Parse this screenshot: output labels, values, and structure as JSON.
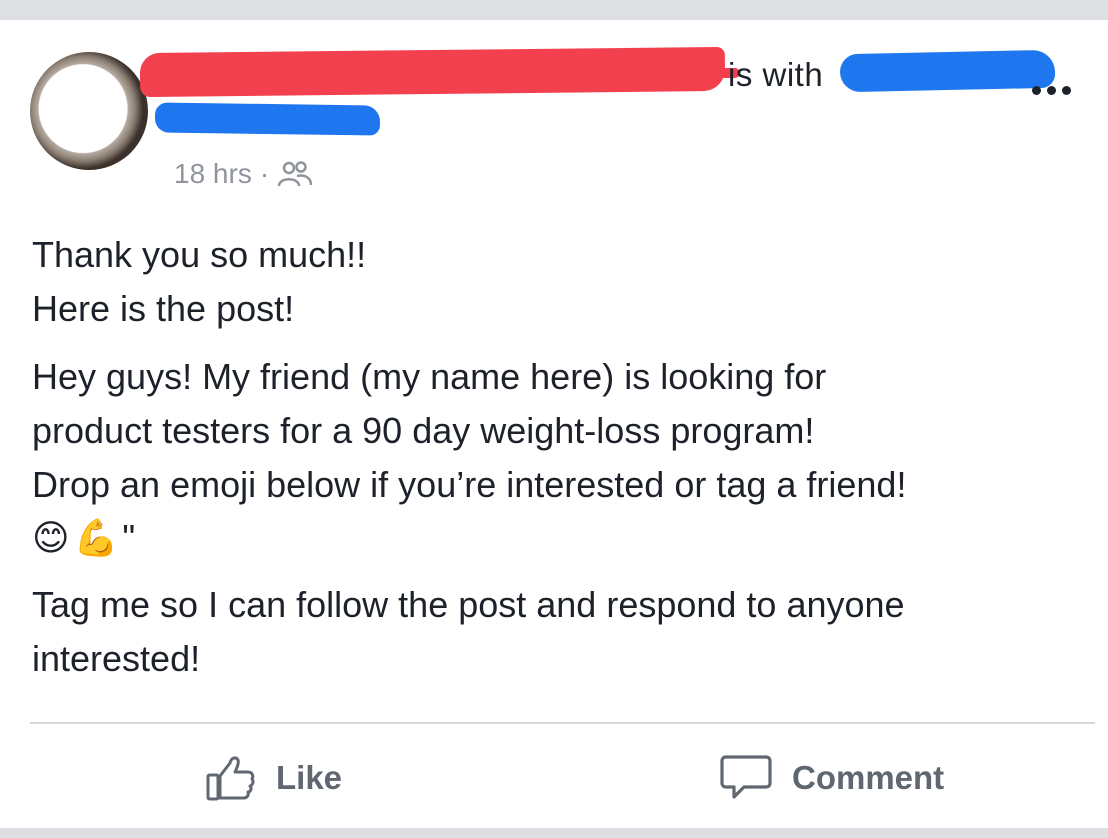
{
  "post": {
    "is_with": "is with",
    "time": "18 hrs",
    "separator": "·",
    "audience_icon": "friends-icon",
    "lines": {
      "l1": "Thank you so much!!",
      "l2": "Here is the post!",
      "l3": "Hey guys! My friend (my name here) is looking for",
      "l4": "product testers for a 90 day weight-loss program!",
      "l5": "Drop an emoji below if you’re interested or tag a friend!",
      "emoji_smile": "😊",
      "emoji_muscle": "💪",
      "quote_mark": "\"",
      "l6": "Tag me so I can follow the post and respond to anyone",
      "l7": "interested!"
    }
  },
  "actions": {
    "like_label": "Like",
    "comment_label": "Comment"
  },
  "colors": {
    "redaction_red": "#f2404f",
    "redaction_blue": "#1f77f0",
    "meta_gray": "#90949c",
    "action_gray": "#606770"
  }
}
